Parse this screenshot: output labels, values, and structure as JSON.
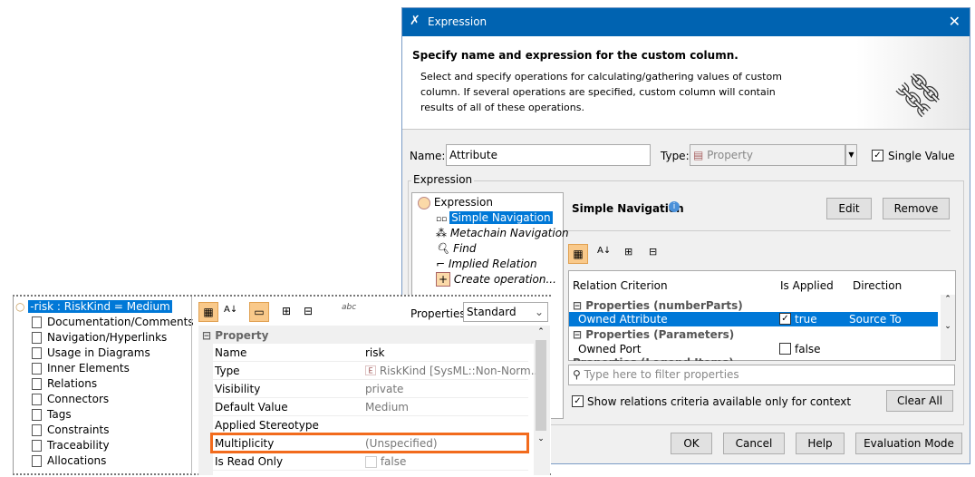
{
  "dialog": {
    "title": "Expression",
    "close": "✕",
    "heading": "Specify name and expression for the custom column.",
    "description": "Select and specify operations for calculating/gathering values of custom column. If several operations are specified, custom column will contain results of all of these operations.",
    "name_label": "Name:",
    "name_value": "Attribute",
    "type_label": "Type:",
    "type_value": "Property",
    "single_value_label": "Single Value",
    "single_value_checked": true,
    "expression_group": "Expression",
    "tree": {
      "root": "Expression",
      "items": [
        "Simple Navigation",
        "Metachain Navigation",
        "Find",
        "Implied Relation",
        "Create operation..."
      ]
    },
    "section_title": "Simple Navigation",
    "edit": "Edit",
    "remove": "Remove",
    "table": {
      "columns": [
        "Relation Criterion",
        "Is Applied",
        "Direction"
      ],
      "groups": [
        "Properties (numberParts)",
        "Properties (Parameters)",
        "Properties (Legend Items)"
      ],
      "rows": [
        {
          "criterion": "Owned Attribute",
          "applied": "true",
          "direction": "Source To Target"
        },
        {
          "criterion": "Owned Port",
          "applied": "false",
          "direction": ""
        }
      ]
    },
    "filter_placeholder": "Type here to filter properties",
    "show_context_label": "Show relations criteria available only for context",
    "clear_all": "Clear All",
    "ok": "OK",
    "cancel": "Cancel",
    "help": "Help",
    "evaluation_mode": "Evaluation Mode"
  },
  "overlay": {
    "tree_root": "-risk : RiskKind = Medium",
    "tree_items": [
      "Documentation/Comments",
      "Navigation/Hyperlinks",
      "Usage in Diagrams",
      "Inner Elements",
      "Relations",
      "Connectors",
      "Tags",
      "Constraints",
      "Traceability",
      "Allocations"
    ],
    "properties_label": "Properties:",
    "properties_mode": "Standard",
    "group": "Property",
    "props": [
      {
        "k": "Name",
        "v": "risk"
      },
      {
        "k": "Type",
        "v": "RiskKind [SysML::Non-Norm..."
      },
      {
        "k": "Visibility",
        "v": "private"
      },
      {
        "k": "Default Value",
        "v": "Medium"
      },
      {
        "k": "Applied Stereotype",
        "v": ""
      },
      {
        "k": "Multiplicity",
        "v": "(Unspecified)"
      },
      {
        "k": "Is Read Only",
        "v": "false"
      }
    ],
    "abc": "abc"
  },
  "colors": {
    "accent": "#0078d7",
    "highlight": "#f26b1d"
  }
}
